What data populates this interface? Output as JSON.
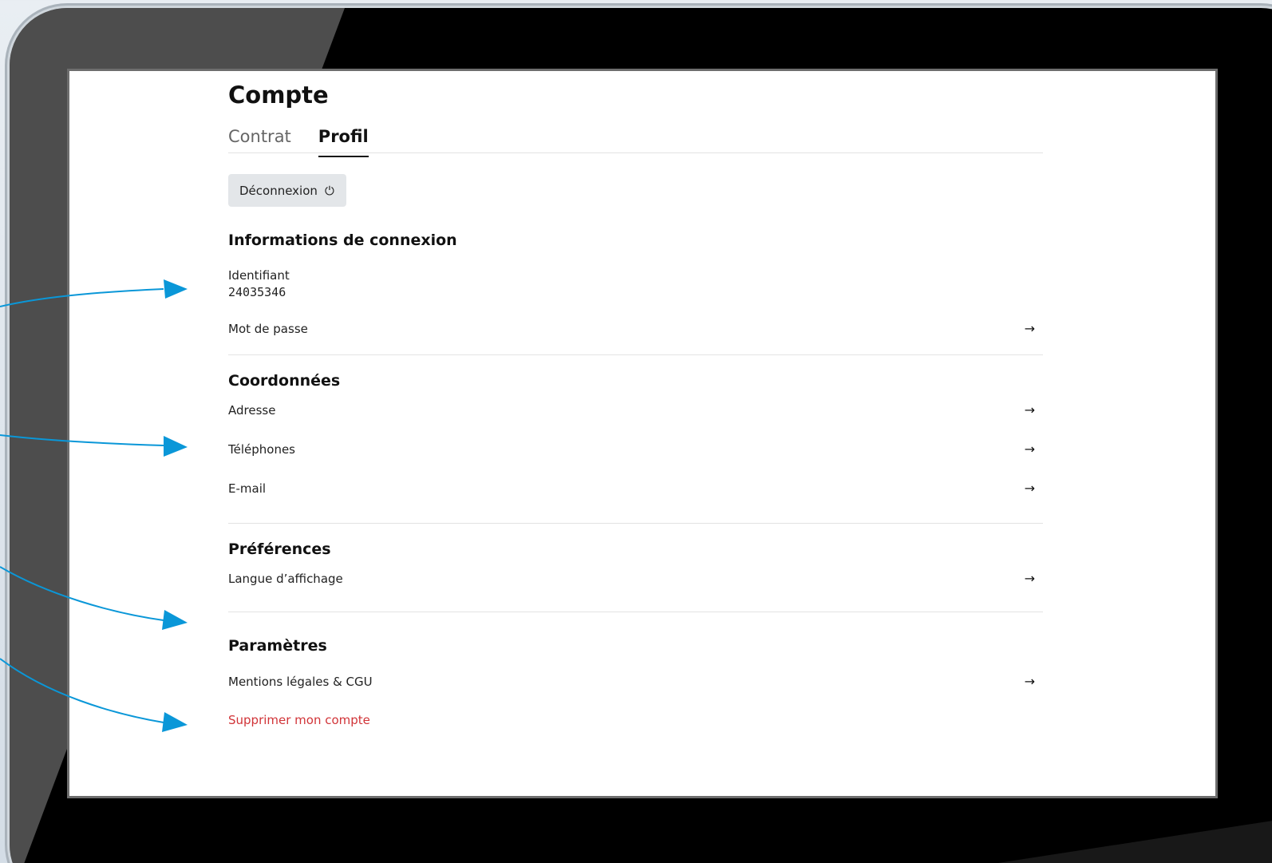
{
  "page": {
    "title": "Compte",
    "tabs": [
      {
        "label": "Contrat",
        "active": false
      },
      {
        "label": "Profil",
        "active": true
      }
    ],
    "logout_label": "Déconnexion",
    "logout_icon": "power-icon",
    "power_glyph": "⏻",
    "arrow_glyph": "→"
  },
  "sections": {
    "login": {
      "title": "Informations de connexion",
      "id_label": "Identifiant",
      "id_value": "24035346",
      "password_label": "Mot de passe"
    },
    "contact": {
      "title": "Coordonnées",
      "items": [
        "Adresse",
        "Téléphones",
        "E-mail"
      ]
    },
    "preferences": {
      "title": "Préférences",
      "items": [
        "Langue d’affichage"
      ]
    },
    "settings": {
      "title": "Paramètres",
      "items": [
        "Mentions légales & CGU"
      ],
      "delete_label": "Supprimer mon compte"
    }
  },
  "colors": {
    "annotation_arrow": "#0a97d8",
    "danger": "#d13438",
    "button_bg": "#e3e6e9"
  }
}
